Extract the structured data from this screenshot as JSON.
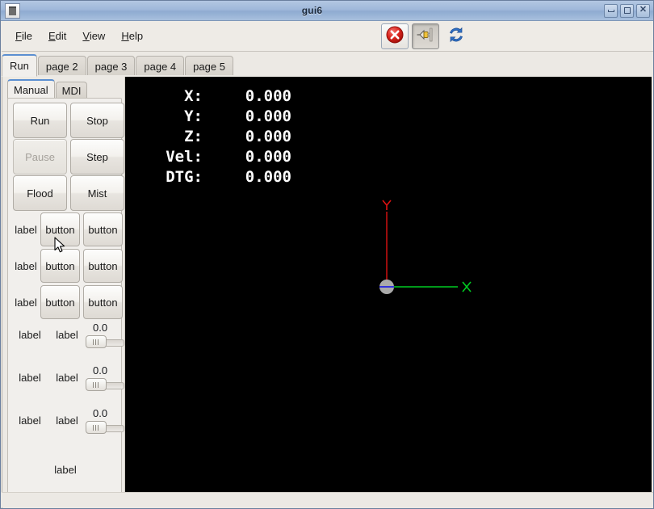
{
  "window": {
    "title": "gui6",
    "icon": "app-icon",
    "controls": [
      {
        "name": "minimize",
        "glyph": "minimize-icon"
      },
      {
        "name": "maximize",
        "glyph": "maximize-icon"
      },
      {
        "name": "close",
        "glyph": "close-icon"
      }
    ]
  },
  "menubar": {
    "items": [
      {
        "mnemonic": "F",
        "rest": "ile"
      },
      {
        "mnemonic": "E",
        "rest": "dit"
      },
      {
        "mnemonic": "V",
        "rest": "iew"
      },
      {
        "mnemonic": "H",
        "rest": "elp"
      }
    ]
  },
  "toolbar": {
    "buttons": [
      {
        "name": "estop-toggle-button",
        "icon": "red-x-circle-icon",
        "state": "framed"
      },
      {
        "name": "machine-power-button",
        "icon": "power-plug-icon",
        "state": "pressed"
      },
      {
        "name": "reload-button",
        "icon": "refresh-arrows-icon",
        "state": "flat"
      }
    ]
  },
  "notebook": {
    "tabs": [
      {
        "label": "Run",
        "active": true
      },
      {
        "label": "page 2",
        "active": false
      },
      {
        "label": "page 3",
        "active": false
      },
      {
        "label": "page 4",
        "active": false
      },
      {
        "label": "page 5",
        "active": false
      }
    ]
  },
  "left_panel": {
    "inner_tabs": [
      {
        "label": "Manual",
        "active": true
      },
      {
        "label": "MDI",
        "active": false
      }
    ],
    "big_buttons": [
      {
        "label": "Run",
        "disabled": false
      },
      {
        "label": "Stop",
        "disabled": false
      },
      {
        "label": "Pause",
        "disabled": true
      },
      {
        "label": "Step",
        "disabled": false
      },
      {
        "label": "Flood",
        "disabled": false
      },
      {
        "label": "Mist",
        "disabled": false
      }
    ],
    "label_button_rows": [
      {
        "label": "label",
        "button1": "button",
        "button2": "button"
      },
      {
        "label": "label",
        "button1": "button",
        "button2": "button"
      },
      {
        "label": "label",
        "button1": "button",
        "button2": "button"
      }
    ],
    "slider_rows": [
      {
        "label1": "label",
        "label2": "label",
        "value": "0.0"
      },
      {
        "label1": "label",
        "label2": "label",
        "value": "0.0"
      },
      {
        "label1": "label",
        "label2": "label",
        "value": "0.0"
      }
    ],
    "bottom_label": "label"
  },
  "display": {
    "dro": [
      {
        "axis": "X:",
        "value": "0.000"
      },
      {
        "axis": "Y:",
        "value": "0.000"
      },
      {
        "axis": "Z:",
        "value": "0.000"
      },
      {
        "axis": "Vel:",
        "value": "0.000"
      },
      {
        "axis": "DTG:",
        "value": "0.000"
      }
    ],
    "axis_graphic": {
      "x_label": "X",
      "y_label": "Y",
      "x_color": "#00cc22",
      "y_color": "#dd1111",
      "origin_color": "#aaaaaa",
      "tool_color": "#3333dd"
    },
    "background": "#000000"
  }
}
